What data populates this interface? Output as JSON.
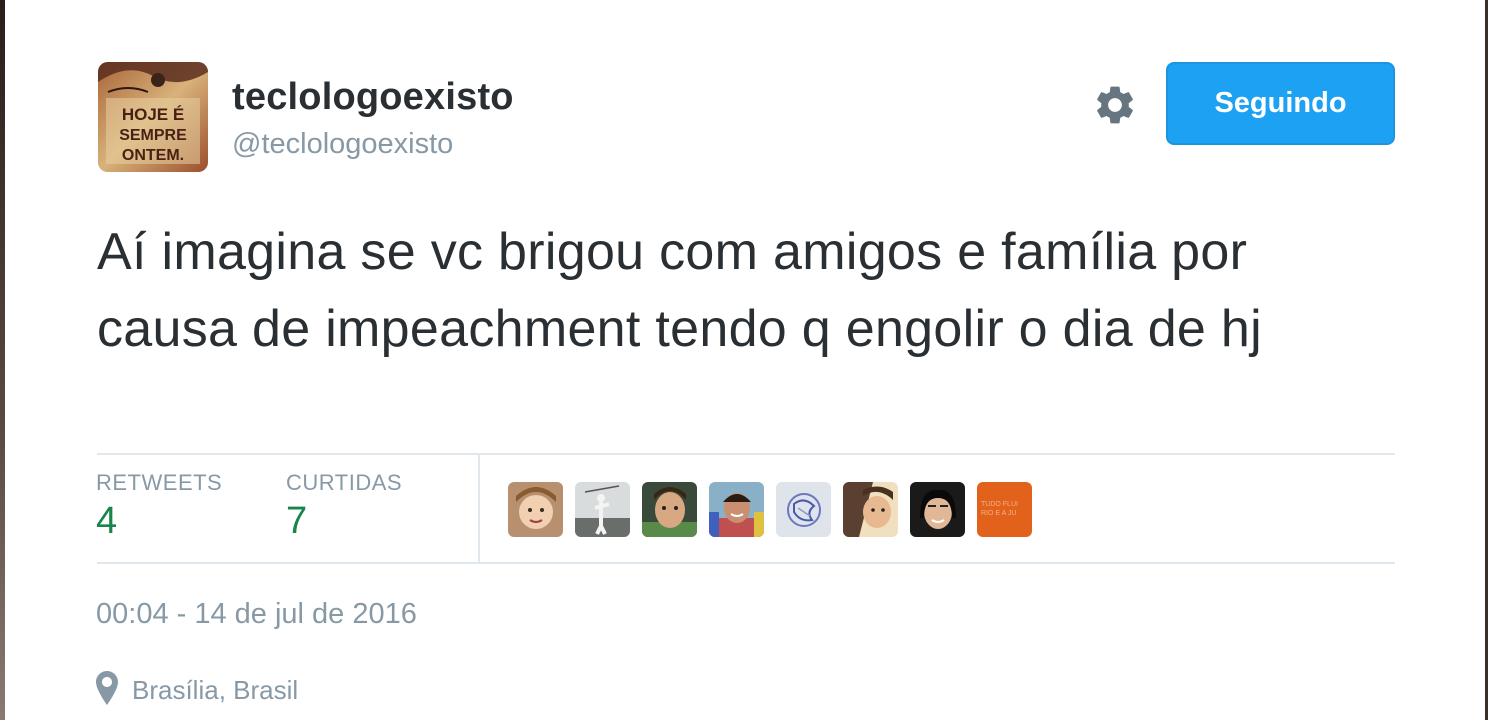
{
  "tweet": {
    "author": {
      "name": "teclologoexisto",
      "handle": "@teclologoexisto",
      "avatar_text": [
        "HOJE É",
        "SEMPRE",
        "ONTEM."
      ]
    },
    "follow_button": "Seguindo",
    "text": "Aí imagina se vc brigou com amigos e família por causa de impeachment tendo q engolir o dia de hj",
    "stats": {
      "retweets_label": "RETWEETS",
      "retweets_count": "4",
      "likes_label": "CURTIDAS",
      "likes_count": "7"
    },
    "likers_count": 8,
    "timestamp": "00:04 - 14 de jul de 2016",
    "location": "Brasília, Brasil"
  },
  "colors": {
    "follow_button": "#1da1f2",
    "stat_value": "#18864b",
    "secondary_text": "#8899a6",
    "primary_text": "#292f33"
  },
  "icons": {
    "settings": "gear-icon",
    "location": "map-pin-icon"
  }
}
